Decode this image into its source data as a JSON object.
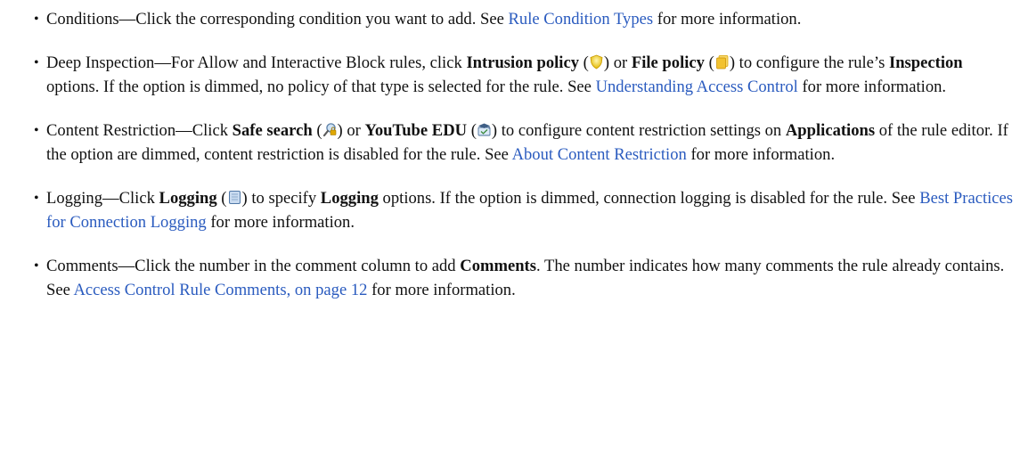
{
  "items": [
    {
      "id": "conditions",
      "t1": "Conditions—Click the corresponding condition you want to add. See ",
      "link": "Rule Condition Types",
      "t2": " for more information."
    },
    {
      "id": "deep-inspection",
      "t1": "Deep Inspection—For Allow and Interactive Block rules, click ",
      "b1": "Intrusion policy",
      "p1": " (",
      "icon1": "intrusion-policy-shield-icon",
      "p2": ") or ",
      "b2": "File policy",
      "p3": " (",
      "icon2": "file-policy-icon",
      "p4": ") to configure the rule’s ",
      "b3": "Inspection",
      "t2": " options. If the option is dimmed, no policy of that type is selected for the rule. See ",
      "link": "Understanding Access Control",
      "t3": " for more information."
    },
    {
      "id": "content-restriction",
      "t1": "Content Restriction—Click ",
      "b1": "Safe search",
      "p1": " (",
      "icon1": "safe-search-icon",
      "p2": ") or ",
      "b2": "YouTube EDU",
      "p3": " (",
      "icon2": "youtube-edu-icon",
      "p4": ") to configure content restriction settings on ",
      "b3": "Applications",
      "t2": " of the rule editor. If the option are dimmed, content restriction is disabled for the rule. See ",
      "link": "About Content Restriction",
      "t3": " for more information."
    },
    {
      "id": "logging",
      "t1": "Logging—Click ",
      "b1": "Logging",
      "p1": " (",
      "icon1": "logging-icon",
      "p2": ") to specify ",
      "b2": "Logging",
      "t2": " options. If the option is dimmed, connection logging is disabled for the rule. See ",
      "link": "Best Practices for Connection Logging",
      "t3": " for more information."
    },
    {
      "id": "comments",
      "t1": "Comments—Click the number in the comment column to add ",
      "b1": "Comments",
      "t2": ". The number indicates how many comments the rule already contains. See ",
      "link": "Access Control Rule Comments, on page 12",
      "t3": " for more information."
    }
  ]
}
